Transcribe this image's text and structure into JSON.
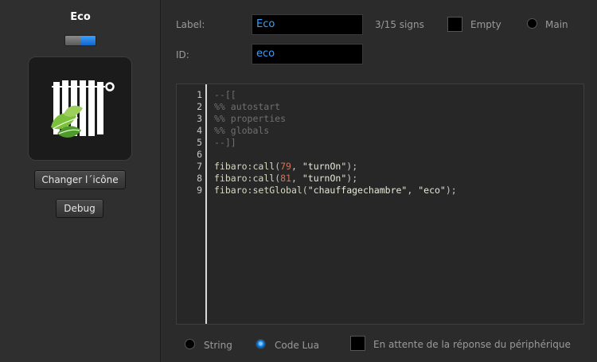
{
  "sidebar": {
    "title": "Eco",
    "toggle_state": "on",
    "change_icon_label": "Changer l´icône",
    "debug_label": "Debug",
    "icon": "radiator-eco-leaves-icon"
  },
  "form": {
    "label_caption": "Label:",
    "label_value": "Eco",
    "signs_counter": "3/15 signs",
    "empty_label": "Empty",
    "main_label": "Main",
    "id_caption": "ID:",
    "id_value": "eco"
  },
  "editor": {
    "line_numbers": [
      "1",
      "2",
      "3",
      "4",
      "5",
      "6",
      "7",
      "8",
      "9"
    ],
    "lines": [
      "--[[",
      "%% autostart",
      "%% properties",
      "%% globals",
      "--]]",
      "",
      "fibaro:call(79, \"turnOn\");",
      "fibaro:call(81, \"turnOn\");",
      "fibaro:setGlobal(\"chauffagechambre\", \"eco\");"
    ]
  },
  "footer": {
    "string_label": "String",
    "lua_label": "Code Lua",
    "selected_mode": "Code Lua",
    "waiting_label": "En attente de la réponse du périphérique"
  },
  "colors": {
    "accent": "#3aa0ff",
    "number": "#d2735a",
    "comment": "#707070"
  }
}
